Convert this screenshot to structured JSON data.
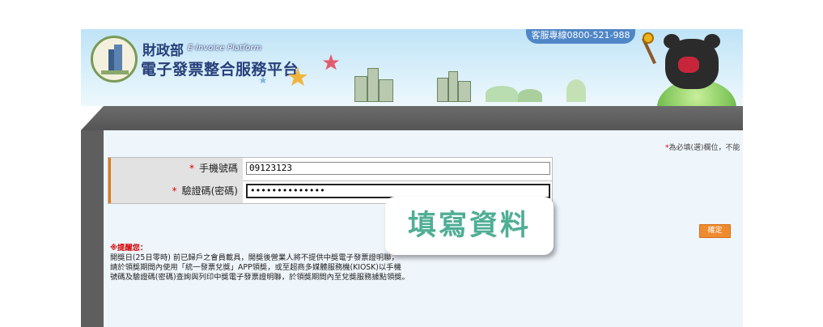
{
  "header": {
    "hotline": "客服專線0800-521-988",
    "brand_ministry": "財政部",
    "brand_en": "E-Invoice Platform",
    "brand_title": "電子發票整合服務平台"
  },
  "form": {
    "required_note_mark": "*",
    "required_note_text": "為必填(選)欄位，不能",
    "phone_label": "手機號碼",
    "phone_value": "09123123",
    "password_label": "驗證碼(密碼)",
    "password_value": "••••••••••••••",
    "required_asterisk": "*"
  },
  "confirm_label": "確定",
  "notice": {
    "title": "※提醒您：",
    "line1": "開獎日(25日零時) 前已歸戶之會員載具，開獎後營業人將不提供中獎電子發票證明聯，",
    "line2": "請於領獎期間內使用「統一發票兌獎」APP領獎，或至超商多媒體服務機(KIOSK)以手機",
    "line3": "號碼及驗證碼(密碼)查詢與列印中獎電子發票證明聯，於領獎期間內至兌獎服務據點領獎。"
  },
  "badge": "填寫資料",
  "colors": {
    "accent": "#ef8b2f",
    "brand_blue": "#27407a",
    "badge_text": "#4fae95",
    "frame_gray": "#5e5e5e"
  }
}
